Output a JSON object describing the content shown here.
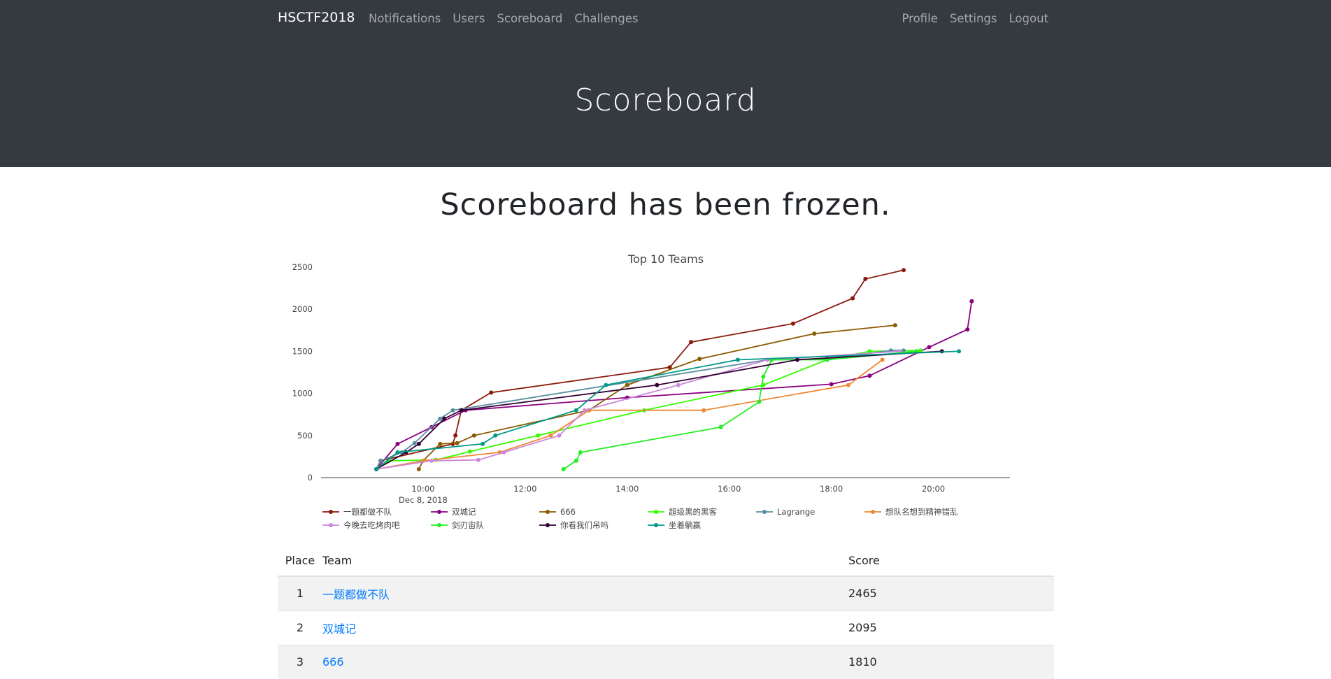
{
  "nav": {
    "brand": "HSCTF2018",
    "left_links": [
      "Notifications",
      "Users",
      "Scoreboard",
      "Challenges"
    ],
    "right_links": [
      "Profile",
      "Settings",
      "Logout"
    ]
  },
  "page": {
    "title": "Scoreboard",
    "frozen_message": "Scoreboard has been frozen."
  },
  "chart_data": {
    "type": "line",
    "title": "Top 10 Teams",
    "x_axis": {
      "range": [
        "2018-12-08 08:00",
        "2018-12-08 21:30"
      ],
      "ticks": [
        "10:00",
        "12:00",
        "14:00",
        "16:00",
        "18:00",
        "20:00"
      ],
      "date_label": "Dec 8, 2018"
    },
    "y_axis": {
      "range": [
        0,
        2600
      ],
      "ticks": [
        0,
        500,
        1000,
        1500,
        2000,
        2500
      ]
    },
    "grid": false,
    "legend_position": "bottom",
    "series": [
      {
        "name": "一题都做不队",
        "color": "#8b1a0a",
        "points": [
          [
            "09:05",
            100
          ],
          [
            "09:10",
            200
          ],
          [
            "10:35",
            400
          ],
          [
            "10:38",
            500
          ],
          [
            "10:45",
            800
          ],
          [
            "11:20",
            1010
          ],
          [
            "14:50",
            1310
          ],
          [
            "15:15",
            1610
          ],
          [
            "17:15",
            1830
          ],
          [
            "18:25",
            2130
          ],
          [
            "18:40",
            2360
          ],
          [
            "19:25",
            2465
          ]
        ]
      },
      {
        "name": "双城记",
        "color": "#8b0080",
        "points": [
          [
            "09:05",
            100
          ],
          [
            "09:30",
            400
          ],
          [
            "10:10",
            600
          ],
          [
            "10:50",
            800
          ],
          [
            "14:00",
            950
          ],
          [
            "18:00",
            1110
          ],
          [
            "18:45",
            1210
          ],
          [
            "19:55",
            1550
          ],
          [
            "20:40",
            1760
          ],
          [
            "20:45",
            2095
          ]
        ]
      },
      {
        "name": "666",
        "color": "#8b5a00",
        "points": [
          [
            "09:55",
            100
          ],
          [
            "10:00",
            200
          ],
          [
            "10:20",
            400
          ],
          [
            "10:40",
            410
          ],
          [
            "11:00",
            500
          ],
          [
            "13:15",
            800
          ],
          [
            "14:00",
            1100
          ],
          [
            "15:25",
            1410
          ],
          [
            "17:40",
            1710
          ],
          [
            "19:15",
            1810
          ]
        ]
      },
      {
        "name": "超级黑的黑客",
        "color": "#33ff00",
        "points": [
          [
            "09:05",
            100
          ],
          [
            "09:20",
            200
          ],
          [
            "10:15",
            210
          ],
          [
            "10:55",
            310
          ],
          [
            "12:15",
            500
          ],
          [
            "14:20",
            800
          ],
          [
            "16:40",
            1100
          ],
          [
            "17:55",
            1400
          ],
          [
            "18:45",
            1500
          ],
          [
            "19:45",
            1510
          ]
        ]
      },
      {
        "name": "Lagrange",
        "color": "#5a8fa0",
        "points": [
          [
            "09:05",
            100
          ],
          [
            "09:10",
            200
          ],
          [
            "09:35",
            300
          ],
          [
            "09:50",
            410
          ],
          [
            "10:20",
            700
          ],
          [
            "10:35",
            800
          ],
          [
            "16:45",
            1400
          ],
          [
            "17:55",
            1410
          ],
          [
            "19:10",
            1510
          ],
          [
            "19:25",
            1510
          ]
        ]
      },
      {
        "name": "想队名想到精神错乱",
        "color": "#ee8833",
        "points": [
          [
            "09:05",
            100
          ],
          [
            "10:00",
            200
          ],
          [
            "11:30",
            300
          ],
          [
            "12:30",
            500
          ],
          [
            "13:15",
            800
          ],
          [
            "15:30",
            800
          ],
          [
            "18:20",
            1100
          ],
          [
            "19:00",
            1400
          ]
        ]
      },
      {
        "name": "今晚去吃烤肉吧",
        "color": "#cc88dd",
        "points": [
          [
            "09:05",
            100
          ],
          [
            "10:10",
            200
          ],
          [
            "11:05",
            210
          ],
          [
            "11:35",
            300
          ],
          [
            "12:40",
            500
          ],
          [
            "13:10",
            800
          ],
          [
            "15:00",
            1100
          ],
          [
            "16:45",
            1400
          ],
          [
            "19:20",
            1500
          ]
        ]
      },
      {
        "name": "剑刃宙队",
        "color": "#22ee22",
        "points": [
          [
            "12:45",
            100
          ],
          [
            "13:00",
            200
          ],
          [
            "13:05",
            300
          ],
          [
            "15:50",
            600
          ],
          [
            "16:35",
            900
          ],
          [
            "16:40",
            1200
          ],
          [
            "16:50",
            1400
          ],
          [
            "17:55",
            1400
          ],
          [
            "19:40",
            1500
          ]
        ]
      },
      {
        "name": "你看我们吊吗",
        "color": "#330033",
        "points": [
          [
            "09:05",
            100
          ],
          [
            "09:40",
            300
          ],
          [
            "09:55",
            400
          ],
          [
            "10:25",
            700
          ],
          [
            "10:45",
            800
          ],
          [
            "14:35",
            1100
          ],
          [
            "17:20",
            1400
          ],
          [
            "20:10",
            1500
          ]
        ]
      },
      {
        "name": "坐着躺赢",
        "color": "#009988",
        "points": [
          [
            "09:05",
            100
          ],
          [
            "09:30",
            300
          ],
          [
            "11:10",
            400
          ],
          [
            "11:25",
            500
          ],
          [
            "13:00",
            800
          ],
          [
            "13:35",
            1100
          ],
          [
            "16:10",
            1400
          ],
          [
            "20:30",
            1500
          ]
        ]
      }
    ]
  },
  "scoreboard": {
    "headers": {
      "place": "Place",
      "team": "Team",
      "score": "Score"
    },
    "rows": [
      {
        "place": "1",
        "team": "一题都做不队",
        "score": "2465"
      },
      {
        "place": "2",
        "team": "双城记",
        "score": "2095"
      },
      {
        "place": "3",
        "team": "666",
        "score": "1810"
      }
    ]
  }
}
